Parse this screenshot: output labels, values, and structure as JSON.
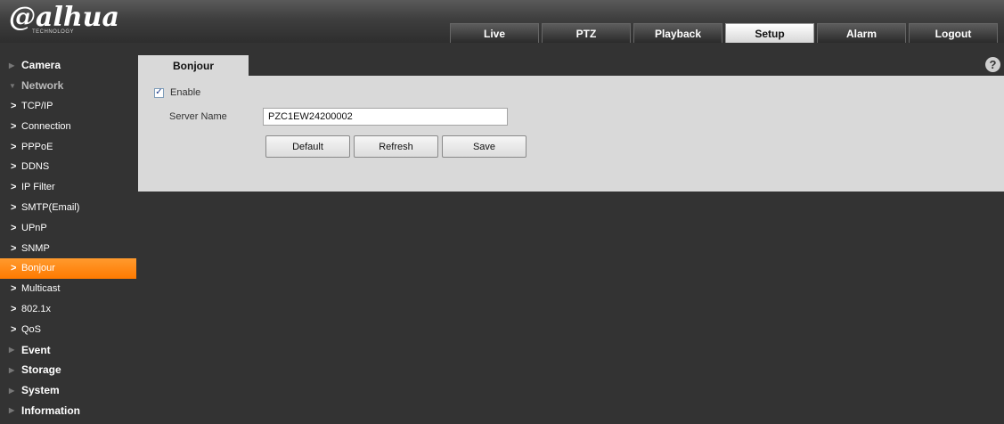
{
  "logo": {
    "text": "alhua",
    "subtitle": "TECHNOLOGY"
  },
  "top_tabs": [
    {
      "label": "Live",
      "active": false
    },
    {
      "label": "PTZ",
      "active": false
    },
    {
      "label": "Playback",
      "active": false
    },
    {
      "label": "Setup",
      "active": true
    },
    {
      "label": "Alarm",
      "active": false
    },
    {
      "label": "Logout",
      "active": false
    }
  ],
  "sidebar": {
    "camera": "Camera",
    "network": "Network",
    "network_items": [
      "TCP/IP",
      "Connection",
      "PPPoE",
      "DDNS",
      "IP Filter",
      "SMTP(Email)",
      "UPnP",
      "SNMP",
      "Bonjour",
      "Multicast",
      "802.1x",
      "QoS"
    ],
    "active_item": "Bonjour",
    "event": "Event",
    "storage": "Storage",
    "system": "System",
    "information": "Information"
  },
  "content": {
    "tab_label": "Bonjour",
    "help_glyph": "?",
    "enable_label": "Enable",
    "enable_checked": true,
    "server_name_label": "Server Name",
    "server_name_value": "PZC1EW24200002",
    "buttons": {
      "default": "Default",
      "refresh": "Refresh",
      "save": "Save"
    }
  },
  "colors": {
    "accent": "#ff8c1a",
    "background": "#333333",
    "panel": "#d9d9d9"
  }
}
